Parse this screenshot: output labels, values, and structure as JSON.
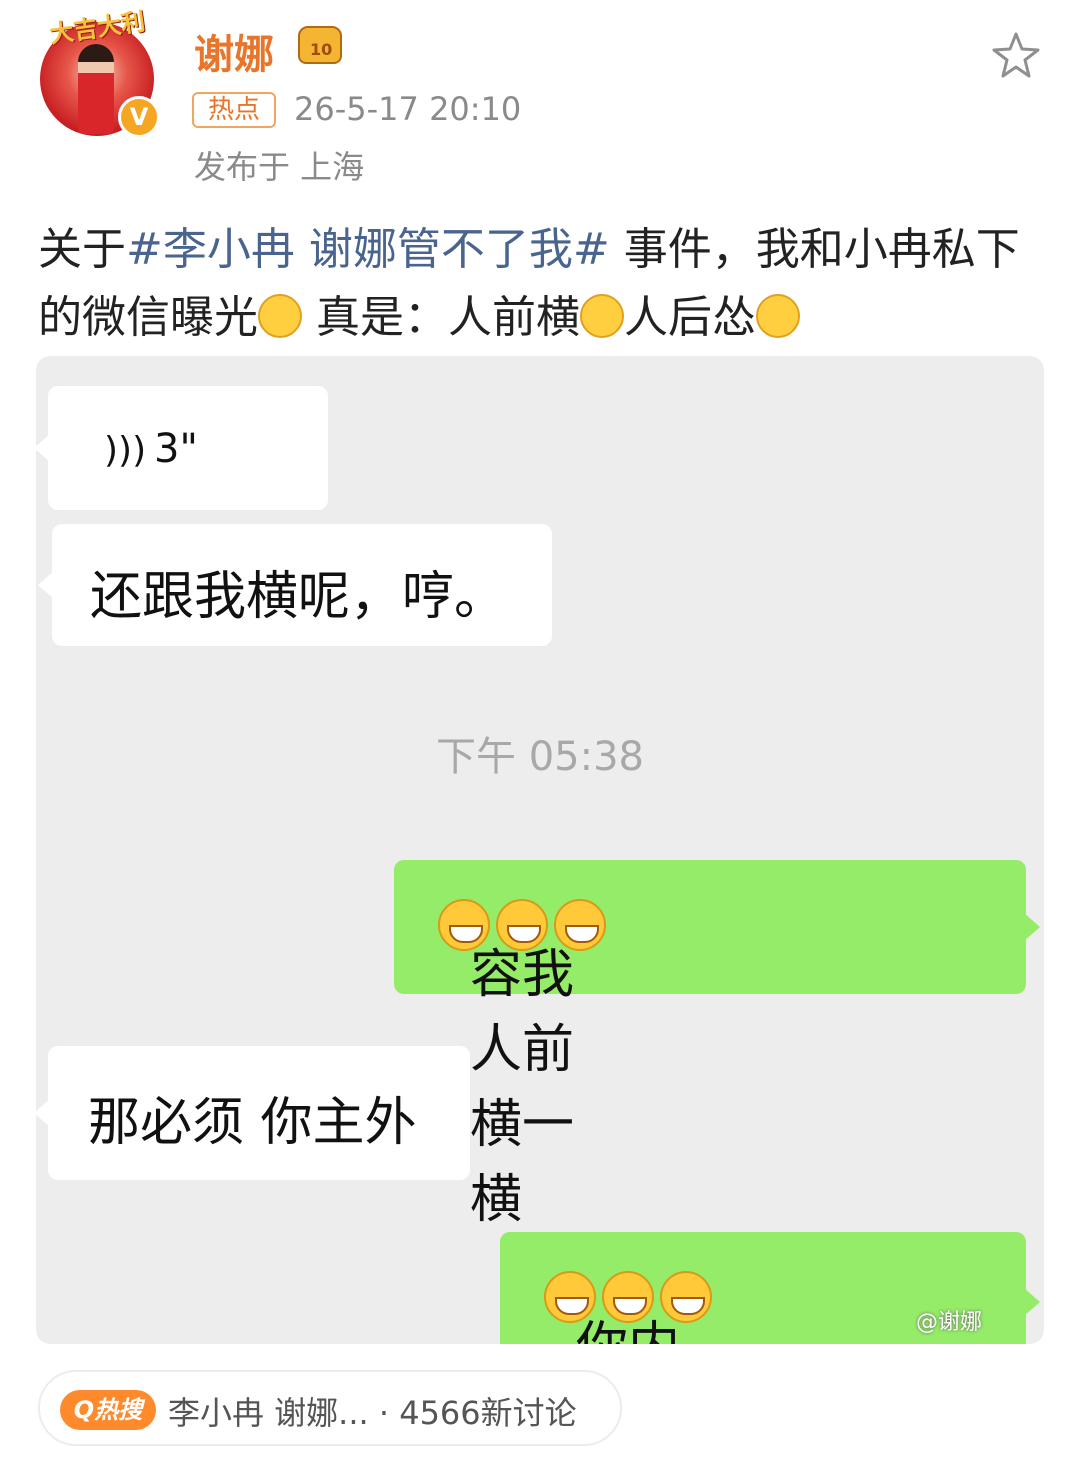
{
  "author": {
    "avatar_banner": "大吉大利",
    "name": "谢娜",
    "vip_level": "10",
    "verified_mark": "V",
    "hot_tag": "热点",
    "time": "26-5-17 20:10",
    "location": "发布于 上海"
  },
  "post": {
    "text_1": "关于",
    "hashtag": "#李小冉 谢娜管不了我#",
    "text_2": " 事件，我和小冉私下的微信曝光",
    "text_3": " 真是：人前横",
    "text_4": "人后怂"
  },
  "chat": {
    "voice_duration": "3\"",
    "msg_1": "还跟我横呢，哼。",
    "timestamp": "下午 05:38",
    "msg_2": "容我人前横一横",
    "msg_3": "那必须 你主外",
    "msg_4": "你内外都主",
    "watermark": "@谢娜"
  },
  "hot_search": {
    "badge": "Q热搜",
    "text": "李小冉 谢娜... · 4566新讨论"
  },
  "icons": [
    "star-icon",
    "voice-wave-icon",
    "laugh-emoji-icon",
    "vip-crown-icon",
    "verified-icon"
  ],
  "colors": {
    "username": "#e8752a",
    "hashtag": "#49658f",
    "bubble_green": "#95ec69",
    "chat_bg": "#ededed",
    "hot_badge": "#ff8a2b"
  }
}
